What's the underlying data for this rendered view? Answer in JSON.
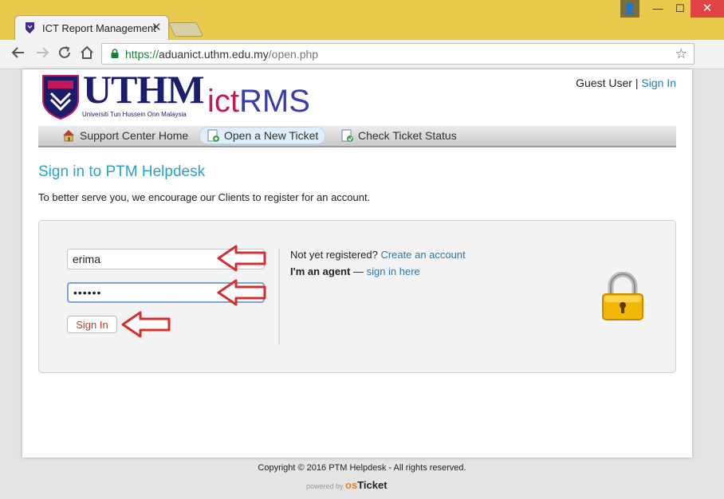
{
  "browser": {
    "tab_title": "ICT Report Management",
    "tab_close": "✕",
    "url_https": "https://",
    "url_host": "aduanict.uthm.edu.my",
    "url_path": "/open.php",
    "window_user": "👤",
    "window_min": "—",
    "window_max": "☐",
    "window_close": "✕"
  },
  "header": {
    "logo_text": "UTHM",
    "logo_subtitle": "Universiti Tun Hussein Onn Malaysia",
    "app_ict": "ict",
    "app_rms": "RMS",
    "guest_label": "Guest User",
    "separator": "|",
    "signin_link": "Sign In"
  },
  "nav": {
    "home": "Support Center Home",
    "open_ticket": "Open a New Ticket",
    "check_status": "Check Ticket Status"
  },
  "main": {
    "heading": "Sign in to PTM Helpdesk",
    "intro": "To better serve you, we encourage our Clients to register for an account.",
    "username_value": "erima",
    "password_value": "••••••",
    "signin_button": "Sign In",
    "not_registered": "Not yet registered?",
    "create_account": "Create an account",
    "agent_label": "I'm an agent",
    "agent_dash": "—",
    "agent_link": "sign in here"
  },
  "footer": {
    "copyright": "Copyright © 2016 PTM Helpdesk - All rights reserved.",
    "powered_by": "powered by",
    "brand_os": "os",
    "brand_ticket": "Ticket"
  },
  "colors": {
    "accent": "#2aa1c8",
    "link": "#2a7ab0",
    "arrow": "#d32f2f",
    "title_bar": "#e8c94c"
  }
}
